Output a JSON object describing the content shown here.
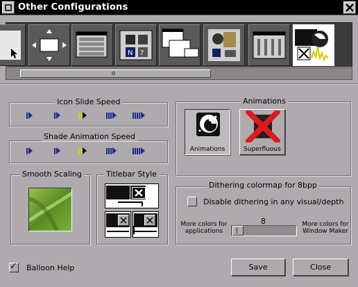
{
  "window": {
    "title": "Other Configurations"
  },
  "icon_strip": {
    "selected_index": 7,
    "panels": [
      {
        "name": "cursor-panel-icon"
      },
      {
        "name": "window-move-panel-icon"
      },
      {
        "name": "menu-panel-icon"
      },
      {
        "name": "appearance-panel-icon"
      },
      {
        "name": "workspace-panel-icon"
      },
      {
        "name": "applications-panel-icon"
      },
      {
        "name": "settings-panel-icon"
      },
      {
        "name": "other-configurations-panel-icon"
      }
    ]
  },
  "icon_slide_speed": {
    "label": "Icon Slide Speed",
    "selected_index": 2
  },
  "shade_animation_speed": {
    "label": "Shade Animation Speed",
    "selected_index": 2
  },
  "smooth_scaling": {
    "label": "Smooth Scaling"
  },
  "titlebar_style": {
    "label": "Titlebar Style"
  },
  "animations": {
    "label": "Animations",
    "animations_button": "Animations",
    "superfluous_button": "Superfluous"
  },
  "dithering": {
    "label": "Dithering colormap for 8bpp",
    "disable_checkbox_label": "Disable dithering in any visual/depth",
    "disable_checked": false,
    "more_for_apps_line1": "More colors for",
    "more_for_apps_line2": "applications",
    "more_for_wm_line1": "More colors for",
    "more_for_wm_line2": "Window Maker",
    "slider_value": "8"
  },
  "balloon_help": {
    "label": "Balloon Help",
    "checked": true,
    "checkmark": "✓"
  },
  "buttons": {
    "save": "Save",
    "close": "Close"
  },
  "colors": {
    "arrow_blue": "#1a2a8e",
    "arrow_selected": "#d8d200",
    "cross_red": "#e01a1a"
  }
}
